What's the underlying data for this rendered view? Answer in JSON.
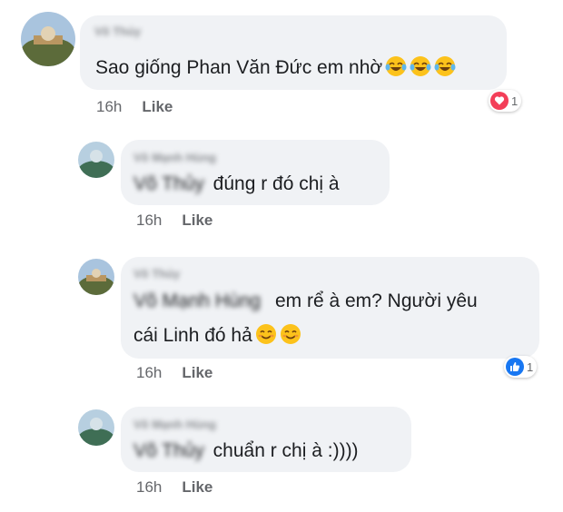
{
  "comments": [
    {
      "author": "Võ Thủy",
      "text": "Sao giống Phan Văn Đức em nhờ",
      "emoji": [
        "face-with-tears-of-joy",
        "face-with-tears-of-joy",
        "face-with-tears-of-joy"
      ],
      "time": "16h",
      "like_label": "Like",
      "reaction": {
        "type": "heart",
        "count": "1",
        "color": "#f33e58"
      }
    },
    {
      "author": "Võ Mạnh Hùng",
      "mention": "Võ Thủy",
      "text": "đúng r đó chị à",
      "time": "16h",
      "like_label": "Like"
    },
    {
      "author": "Võ Thủy",
      "mention": "Võ Mạnh Hùng",
      "text_line1": "em rể à em? Người yêu",
      "text_line2": "cái Linh đó hả",
      "emoji": [
        "smiling-face-with-smiling-eyes",
        "smiling-face-with-smiling-eyes"
      ],
      "time": "16h",
      "like_label": "Like",
      "reaction": {
        "type": "thumbs-up",
        "count": "1",
        "color": "#1877f2"
      }
    },
    {
      "author": "Võ Mạnh Hùng",
      "mention": "Võ Thủy",
      "text": "chuẩn r chị à :))))",
      "time": "16h",
      "like_label": "Like"
    }
  ]
}
